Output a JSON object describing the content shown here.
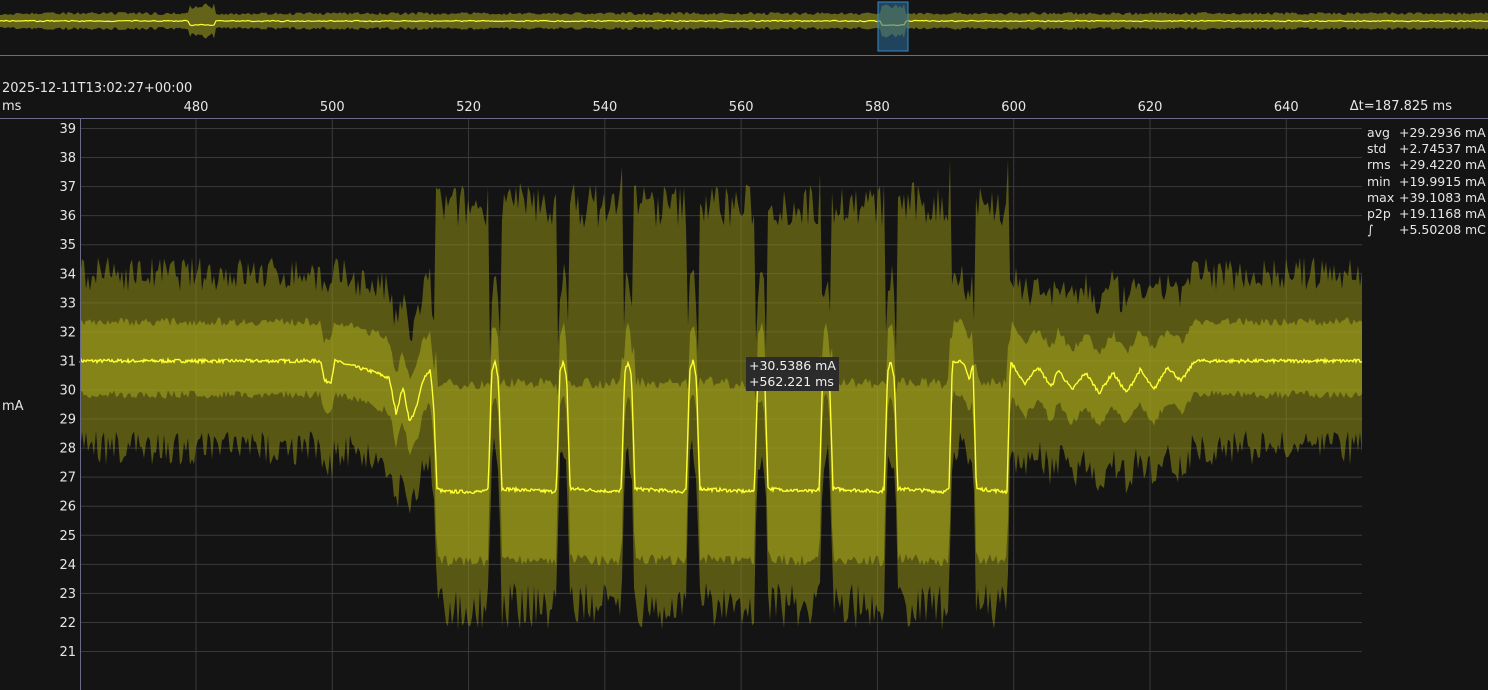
{
  "header": {
    "timestamp": "2025-12-11T13:02:27+00:00",
    "x_unit": "ms",
    "delta": "Δt=187.825 ms",
    "y_unit": "mA"
  },
  "stats": [
    {
      "key": "avg",
      "value": "+29.2936",
      "unit": "mA"
    },
    {
      "key": "std",
      "value": "+2.74537",
      "unit": "mA"
    },
    {
      "key": "rms",
      "value": "+29.4220",
      "unit": "mA"
    },
    {
      "key": "min",
      "value": "+19.9915",
      "unit": "mA"
    },
    {
      "key": "max",
      "value": "+39.1083",
      "unit": "mA"
    },
    {
      "key": "p2p",
      "value": "+19.1168",
      "unit": "mA"
    },
    {
      "key": "∫",
      "value": "+5.50208",
      "unit": "mC"
    }
  ],
  "tooltip": {
    "current": "+30.5386 mA",
    "time": "+562.221 ms",
    "x": 562.221,
    "y": 30.5386
  },
  "colors": {
    "trace": "#ffff33",
    "band_outer": "#6b6b1a",
    "band_inner": "#85851f",
    "grid": "#3a3a3a",
    "axis": "#6a6a8a",
    "background": "#141414",
    "selection": "#2a6a9a"
  },
  "chart_data": {
    "type": "line",
    "xlabel": "ms",
    "ylabel": "mA",
    "xlim": [
      459.7,
      647.5
    ],
    "ylim": [
      20,
      39.4
    ],
    "x_ticks": [
      480,
      500,
      520,
      540,
      560,
      580,
      600,
      620,
      640
    ],
    "y_ticks": [
      21,
      22,
      23,
      24,
      25,
      26,
      27,
      28,
      29,
      30,
      31,
      32,
      33,
      34,
      35,
      36,
      37,
      38,
      39
    ],
    "grid": true,
    "series": [
      {
        "values_note": "",
        "x": [
          459.7,
          463,
          470,
          480,
          490,
          495,
          495.5,
          496.5,
          497,
          503,
          505,
          506,
          507,
          508,
          509,
          510,
          511,
          511.5,
          512,
          513,
          519,
          519.5,
          520,
          520.5,
          521,
          521.5,
          529,
          529.5,
          530,
          530.5,
          531,
          531.5,
          538.5,
          539,
          539.5,
          540,
          540.5,
          541,
          548,
          548.5,
          549,
          549.5,
          550,
          550.5,
          558,
          558.5,
          559,
          559.5,
          560,
          560.5,
          567.5,
          568,
          568.5,
          569,
          569.5,
          570,
          577,
          577.5,
          578,
          578.5,
          579,
          579.5,
          586.5,
          587,
          587.5,
          588,
          589,
          590,
          590.5,
          591,
          595.5,
          596,
          597,
          598,
          600,
          602,
          603,
          605,
          607,
          609,
          611,
          613,
          615,
          617,
          619,
          621,
          623,
          630,
          640,
          647.5
        ],
        "y": [
          31.0,
          31.0,
          31.0,
          31.0,
          31.0,
          31.0,
          30.3,
          30.3,
          31.0,
          30.6,
          30.4,
          29.2,
          30.1,
          28.9,
          29.4,
          30.4,
          30.7,
          29.5,
          26.6,
          26.5,
          26.5,
          26.6,
          30.6,
          31.0,
          30.4,
          26.6,
          26.5,
          26.6,
          30.6,
          31.0,
          30.4,
          26.6,
          26.5,
          26.6,
          30.6,
          31.0,
          30.4,
          26.6,
          26.5,
          26.6,
          30.6,
          31.0,
          30.4,
          26.6,
          26.5,
          26.6,
          30.6,
          31.0,
          30.4,
          26.6,
          26.5,
          26.6,
          30.6,
          31.0,
          30.4,
          26.6,
          26.5,
          26.6,
          30.6,
          31.0,
          30.4,
          26.6,
          26.5,
          26.6,
          31.0,
          31.0,
          31.0,
          30.3,
          31.0,
          26.6,
          26.5,
          31.0,
          30.6,
          30.2,
          30.8,
          30.1,
          30.7,
          30.0,
          30.6,
          29.9,
          30.6,
          29.9,
          30.7,
          30.0,
          30.8,
          30.3,
          31.0,
          31.0,
          31.0,
          31.0
        ]
      }
    ],
    "overview": {
      "selection_range": [
        580,
        585
      ]
    }
  }
}
